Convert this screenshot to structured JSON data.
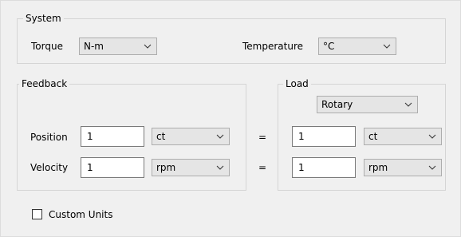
{
  "system": {
    "title": "System",
    "torque_label": "Torque",
    "torque_unit": "N-m",
    "temperature_label": "Temperature",
    "temperature_unit": "°C"
  },
  "feedback": {
    "title": "Feedback",
    "position_label": "Position",
    "position_value": "1",
    "position_unit": "ct",
    "velocity_label": "Velocity",
    "velocity_value": "1",
    "velocity_unit": "rpm"
  },
  "equals": "=",
  "load": {
    "title": "Load",
    "motion_type": "Rotary",
    "position_value": "1",
    "position_unit": "ct",
    "velocity_value": "1",
    "velocity_unit": "rpm"
  },
  "custom_units": {
    "label": "Custom Units",
    "checked": false
  }
}
